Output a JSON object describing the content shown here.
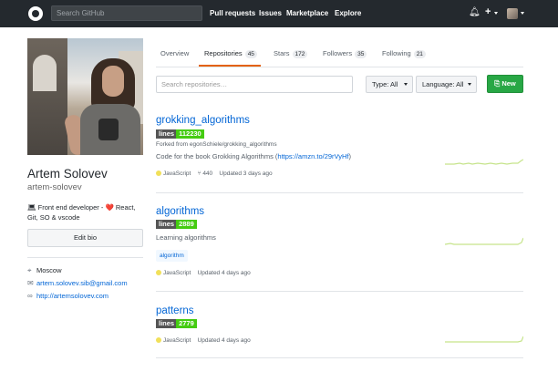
{
  "header": {
    "search_placeholder": "Search GitHub",
    "nav": [
      "Pull requests",
      "Issues",
      "Marketplace",
      "Explore"
    ]
  },
  "profile": {
    "name": "Artem Solovev",
    "login": "artem-solovev",
    "bio_line1": "Front end developer",
    "bio_heart": "❤️",
    "bio_line1_tail": "React,",
    "bio_line2": "Git, SO & vscode",
    "edit_bio": "Edit bio",
    "location": "Moscow",
    "email": "artem.solovev.sib@gmail.com",
    "website": "http://artemsolovev.com"
  },
  "tabs": [
    {
      "label": "Overview",
      "count": ""
    },
    {
      "label": "Repositories",
      "count": "45"
    },
    {
      "label": "Stars",
      "count": "172"
    },
    {
      "label": "Followers",
      "count": "35"
    },
    {
      "label": "Following",
      "count": "21"
    }
  ],
  "filters": {
    "search_placeholder": "Search repositories…",
    "type": "Type: All",
    "language": "Language: All",
    "new_button": "New"
  },
  "repos": [
    {
      "name": "grokking_algorithms",
      "badge_label": "lines",
      "badge_value": "112230",
      "forked_from": "Forked from egonSchiele/grokking_algorithms",
      "description": "Code for the book Grokking Algorithms",
      "link": "https://amzn.to/29rVyHf",
      "language": "JavaScript",
      "forks": "440",
      "updated": "Updated 3 days ago"
    },
    {
      "name": "algorithms",
      "badge_label": "lines",
      "badge_value": "2889",
      "description": "Learning algorithms",
      "topic": "algorithm",
      "language": "JavaScript",
      "updated": "Updated 4 days ago"
    },
    {
      "name": "patterns",
      "badge_label": "lines",
      "badge_value": "2779",
      "language": "JavaScript",
      "updated": "Updated 4 days ago"
    }
  ],
  "colors": {
    "header_bg": "#24292e",
    "link": "#0366d6",
    "new_button": "#28a745",
    "tab_accent": "#e36209",
    "javascript": "#f1e05a",
    "badge_green": "#44cc11"
  }
}
